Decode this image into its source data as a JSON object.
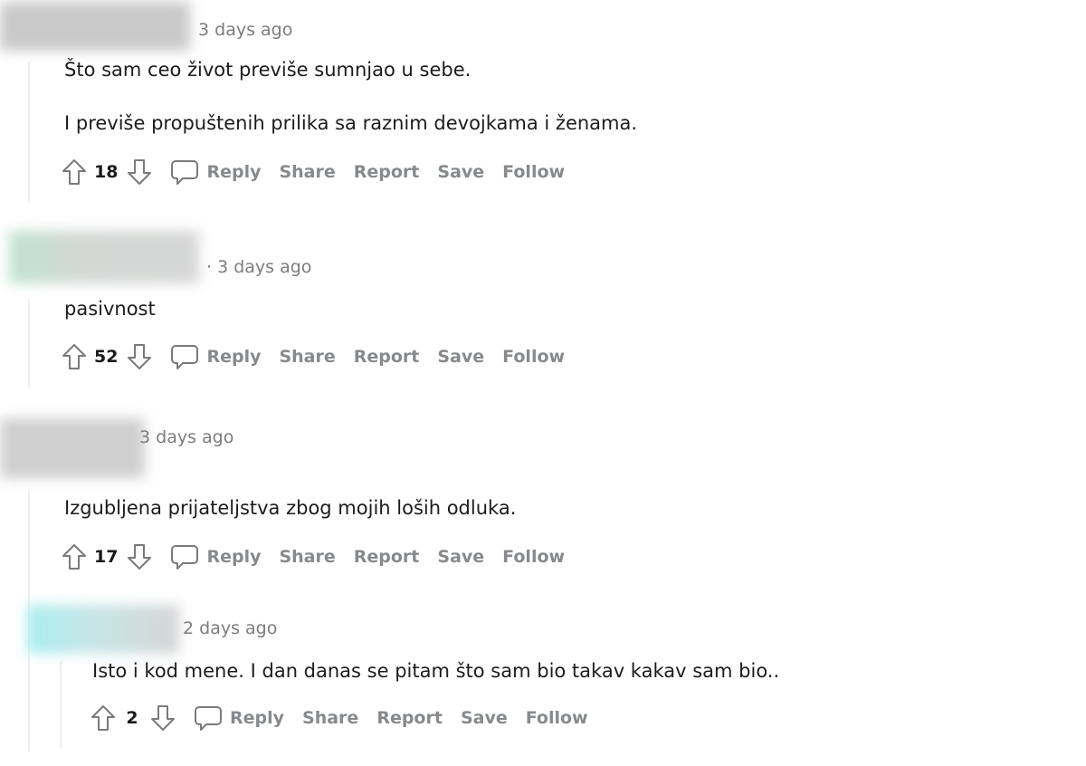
{
  "comments": [
    {
      "timestamp": "3 days ago",
      "paragraphs": [
        "Što sam ceo život previše sumnjao u sebe.",
        "I previše propuštenih prilika sa raznim devojkama i ženama."
      ],
      "score": "18"
    },
    {
      "timestamp": "· 3 days ago",
      "paragraphs": [
        "pasivnost"
      ],
      "score": "52"
    },
    {
      "timestamp": "3 days ago",
      "paragraphs": [
        "Izgubljena prijateljstva zbog mojih loših odluka."
      ],
      "score": "17"
    },
    {
      "timestamp": "2 days ago",
      "paragraphs": [
        "Isto i kod mene. I dan danas se pitam što sam bio takav kakav sam bio.."
      ],
      "score": "2"
    }
  ],
  "actions": {
    "reply": "Reply",
    "share": "Share",
    "report": "Report",
    "save": "Save",
    "follow": "Follow"
  },
  "icons": {
    "upvote": "arrow-up-icon",
    "downvote": "arrow-down-icon",
    "reply": "speech-bubble-icon"
  },
  "colors": {
    "action_text": "#878a8c",
    "timestamp": "#7c7c7c",
    "thread_line": "#edeff1"
  }
}
